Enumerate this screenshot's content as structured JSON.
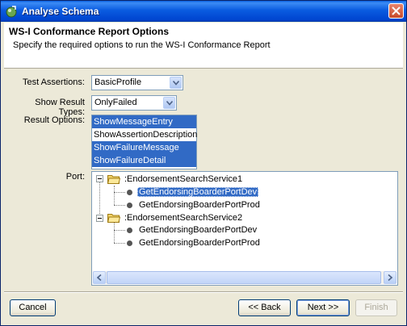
{
  "window": {
    "title": "Analyse Schema"
  },
  "header": {
    "title": "WS-I Conformance Report Options",
    "subtitle": "Specify the required options to run the WS-I Conformance Report"
  },
  "form": {
    "test_assertions_label": "Test Assertions:",
    "test_assertions_value": "BasicProfile",
    "show_result_types_label": "Show Result Types:",
    "show_result_types_value": "OnlyFailed",
    "result_options_label": "Result Options:",
    "result_options": [
      {
        "label": "ShowMessageEntry",
        "selected": true
      },
      {
        "label": "ShowAssertionDescription",
        "selected": false
      },
      {
        "label": "ShowFailureMessage",
        "selected": true
      },
      {
        "label": "ShowFailureDetail",
        "selected": true
      }
    ],
    "port_label": "Port:"
  },
  "tree": {
    "services": [
      {
        "name": ":EndorsementSearchService1",
        "expanded": true,
        "ports": [
          {
            "name": "GetEndorsingBoarderPortDev",
            "selected": true
          },
          {
            "name": "GetEndorsingBoarderPortProd",
            "selected": false
          }
        ]
      },
      {
        "name": ":EndorsementSearchService2",
        "expanded": true,
        "ports": [
          {
            "name": "GetEndorsingBoarderPortDev",
            "selected": false
          },
          {
            "name": "GetEndorsingBoarderPortProd",
            "selected": false
          }
        ]
      }
    ]
  },
  "buttons": {
    "cancel": "Cancel",
    "back": "<< Back",
    "next": "Next >>",
    "finish": "Finish"
  },
  "colors": {
    "selection": "#316ac5",
    "titlebar": "#0a5be0",
    "dialog_bg": "#ece9d8"
  }
}
